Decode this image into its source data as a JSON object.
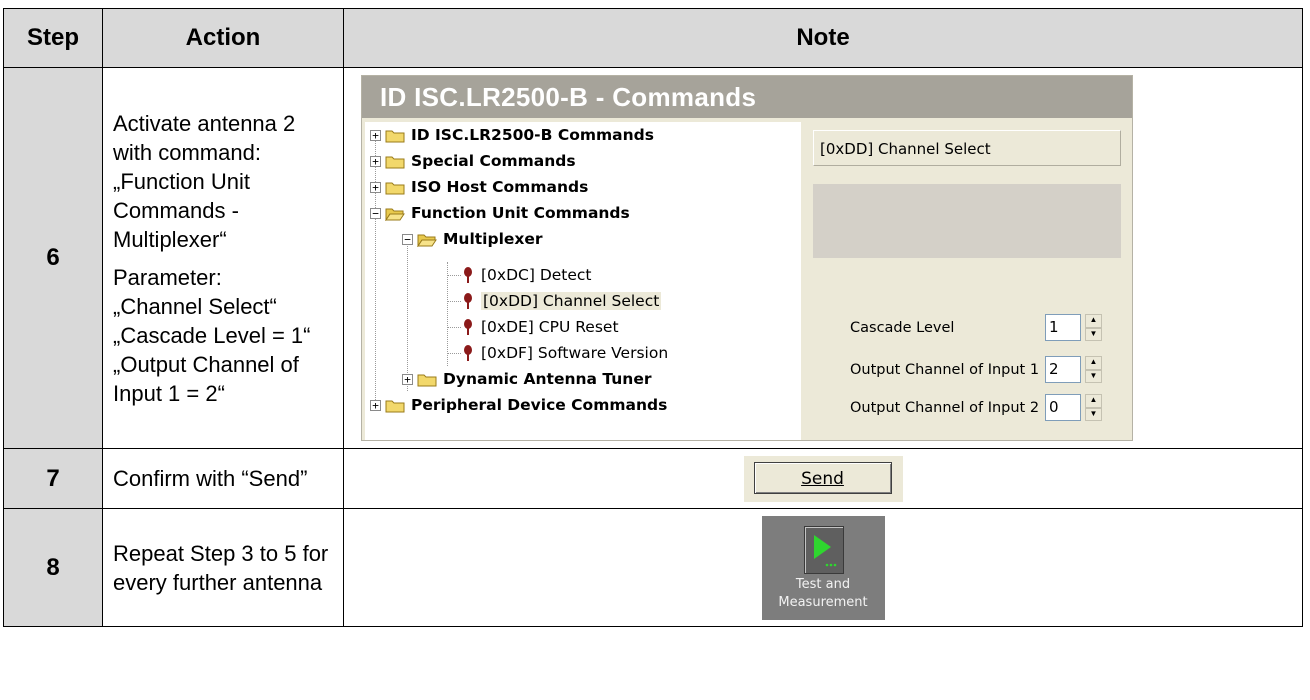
{
  "header": {
    "step": "Step",
    "action": "Action",
    "note": "Note"
  },
  "rows": [
    {
      "step": "6",
      "action_p1": "Activate antenna 2 with command: „Function Unit Commands -  Multiplexer“",
      "action_p2_lines": [
        "Parameter:",
        "„Channel Select“",
        "„Cascade Level = 1“",
        "„Output Channel of Input 1 = 2“"
      ]
    },
    {
      "step": "7",
      "action": "Confirm with “Send”"
    },
    {
      "step": "8",
      "action": "Repeat Step 3 to 5 for every further antenna"
    }
  ],
  "commands_window": {
    "title": "ID ISC.LR2500-B - Commands",
    "tree": [
      {
        "label": "ID ISC.LR2500-B Commands",
        "expander": "+"
      },
      {
        "label": "Special Commands",
        "expander": "+"
      },
      {
        "label": "ISO Host Commands",
        "expander": "+"
      },
      {
        "label": "Function Unit Commands",
        "expander": "−"
      },
      {
        "label": "Multiplexer",
        "expander": "−"
      },
      {
        "label": "[0xDC] Detect"
      },
      {
        "label": "[0xDD] Channel Select"
      },
      {
        "label": "[0xDE] CPU Reset"
      },
      {
        "label": "[0xDF] Software Version"
      },
      {
        "label": "Dynamic Antenna Tuner",
        "expander": "+"
      },
      {
        "label": "Peripheral Device Commands",
        "expander": "+"
      }
    ],
    "selected_command": "[0xDD] Channel Select",
    "params": [
      {
        "label": "Cascade Level",
        "value": "1"
      },
      {
        "label": "Output Channel of Input 1",
        "value": "2"
      },
      {
        "label": "Output Channel of Input 2",
        "value": "0"
      }
    ]
  },
  "send_button": {
    "label": "Send"
  },
  "test_measurement": {
    "line1": "Test and",
    "line2": "Measurement"
  },
  "colors": {
    "folder": "#f2d86b",
    "leaf_pin": "#8b1a1a",
    "play_icon": "#2fd62f",
    "header_bg": "#d9d9d9"
  }
}
